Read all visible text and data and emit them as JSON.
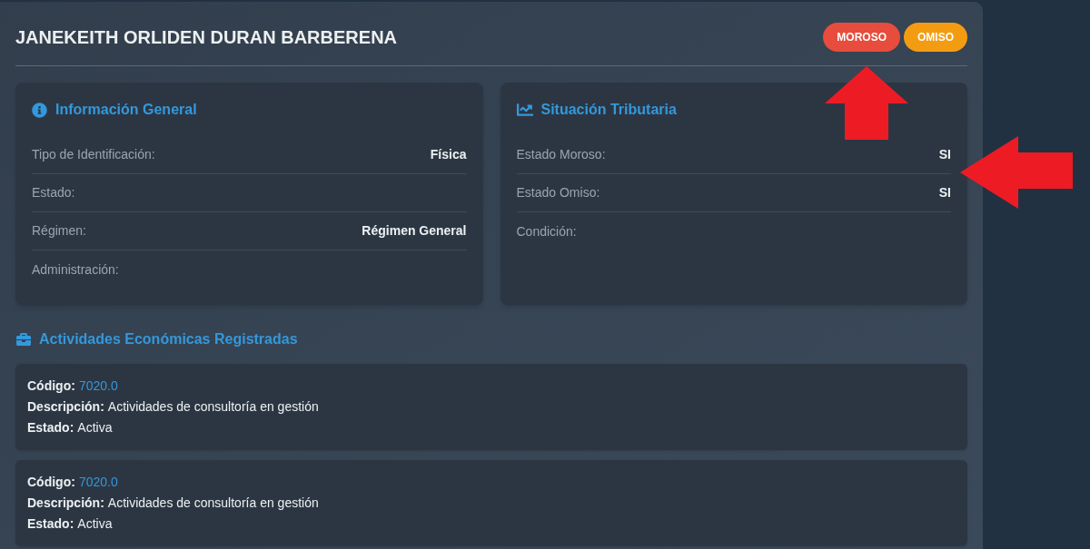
{
  "header": {
    "name": "JANEKEITH ORLIDEN DURAN BARBERENA",
    "badges": [
      {
        "label": "MOROSO",
        "color": "#e74c3c"
      },
      {
        "label": "OMISO",
        "color": "#f39c12"
      }
    ]
  },
  "cards": [
    {
      "kind": "info",
      "title": "Información General",
      "rows": [
        {
          "label": "Tipo de Identificación:",
          "value": "Física"
        },
        {
          "label": "Estado:"
        },
        {
          "label": "Régimen:",
          "value": "Régimen General"
        },
        {
          "label": "Administración:"
        }
      ]
    },
    {
      "kind": "chart",
      "title": "Situación Tributaria",
      "rows": [
        {
          "label": "Estado Moroso:",
          "value": "SI"
        },
        {
          "label": "Estado Omiso:",
          "value": "SI"
        },
        {
          "label": "Condición:"
        }
      ]
    }
  ],
  "activities": {
    "title": "Actividades Económicas Registradas",
    "items": [
      {
        "fields": [
          {
            "kind": "code",
            "label": "Código:",
            "value": "7020.0"
          },
          {
            "kind": "text",
            "label": "Descripción:",
            "value": "Actividades de consultoría en gestión"
          },
          {
            "kind": "text",
            "label": "Estado:",
            "value": "Activa"
          }
        ]
      },
      {
        "fields": [
          {
            "kind": "code",
            "label": "Código:",
            "value": "7020.0"
          },
          {
            "kind": "text",
            "label": "Descripción:",
            "value": "Actividades de consultoría en gestión"
          },
          {
            "kind": "text",
            "label": "Estado:",
            "value": "Activa"
          }
        ]
      }
    ]
  }
}
